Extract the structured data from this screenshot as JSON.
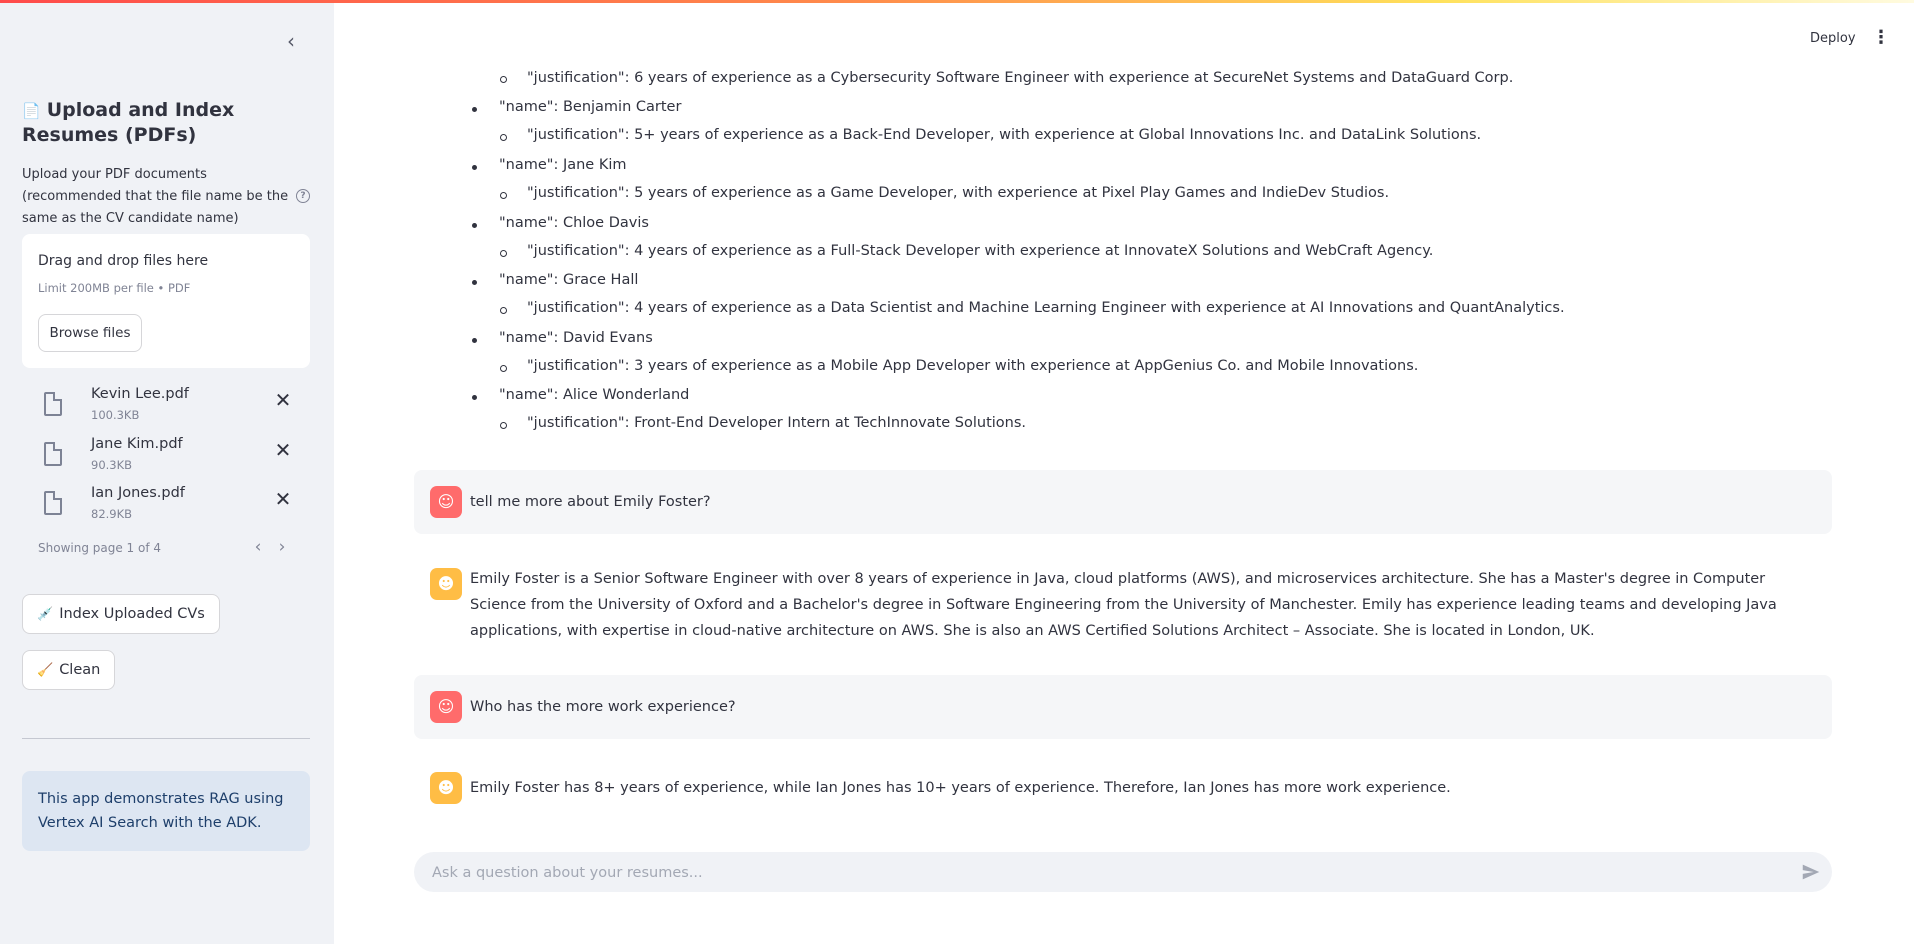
{
  "sidebar": {
    "collapse_glyph": "‹",
    "title": "Upload and Index Resumes (PDFs)",
    "title_icon": "📄",
    "upload_label": "Upload your PDF documents (recommended that the file name be the same as the CV candidate name)",
    "dropzone": {
      "title": "Drag and drop files here",
      "limit": "Limit 200MB per file • PDF",
      "browse_label": "Browse files"
    },
    "files": [
      {
        "name": "Kevin Lee.pdf",
        "size": "100.3KB"
      },
      {
        "name": "Jane Kim.pdf",
        "size": "90.3KB"
      },
      {
        "name": "Ian Jones.pdf",
        "size": "82.9KB"
      }
    ],
    "pager_text": "Showing page 1 of 4",
    "index_button": {
      "icon": "💉",
      "label": "Index Uploaded CVs"
    },
    "clean_button": {
      "icon": "🧹",
      "label": "Clean"
    },
    "info": "This app demonstrates RAG using Vertex AI Search with the ADK."
  },
  "header": {
    "deploy_label": "Deploy",
    "menu_glyph": "⋮"
  },
  "results": [
    {
      "justification": "\"justification\": 6 years of experience as a Cybersecurity Software Engineer with experience at SecureNet Systems and DataGuard Corp."
    },
    {
      "name": "\"name\": Benjamin Carter",
      "justification": "\"justification\": 5+ years of experience as a Back-End Developer, with experience at Global Innovations Inc. and DataLink Solutions."
    },
    {
      "name": "\"name\": Jane Kim",
      "justification": "\"justification\": 5 years of experience as a Game Developer, with experience at Pixel Play Games and IndieDev Studios."
    },
    {
      "name": "\"name\": Chloe Davis",
      "justification": "\"justification\": 4 years of experience as a Full-Stack Developer with experience at InnovateX Solutions and WebCraft Agency."
    },
    {
      "name": "\"name\": Grace Hall",
      "justification": "\"justification\": 4 years of experience as a Data Scientist and Machine Learning Engineer with experience at AI Innovations and QuantAnalytics."
    },
    {
      "name": "\"name\": David Evans",
      "justification": "\"justification\": 3 years of experience as a Mobile App Developer with experience at AppGenius Co. and Mobile Innovations."
    },
    {
      "name": "\"name\": Alice Wonderland",
      "justification": "\"justification\": Front-End Developer Intern at TechInnovate Solutions."
    }
  ],
  "messages": [
    {
      "role": "user",
      "text": "tell me more about Emily Foster?"
    },
    {
      "role": "assistant",
      "text": "Emily Foster is a Senior Software Engineer with over 8 years of experience in Java, cloud platforms (AWS), and microservices architecture. She has a Master's degree in Computer Science from the University of Oxford and a Bachelor's degree in Software Engineering from the University of Manchester. Emily has experience leading teams and developing Java applications, with expertise in cloud-native architecture on AWS. She is also an AWS Certified Solutions Architect – Associate. She is located in London, UK."
    },
    {
      "role": "user",
      "text": "Who has the more work experience?"
    },
    {
      "role": "assistant",
      "text": "Emily Foster has 8+ years of experience, while Ian Jones has 10+ years of experience. Therefore, Ian Jones has more work experience."
    }
  ],
  "chat_input": {
    "placeholder": "Ask a question about your resumes...",
    "value": ""
  },
  "colors": {
    "user_avatar": "#ff6b6b",
    "bot_avatar": "#ffbd45",
    "info_bg": "#dde6f2",
    "sidebar_bg": "#f0f2f6"
  }
}
